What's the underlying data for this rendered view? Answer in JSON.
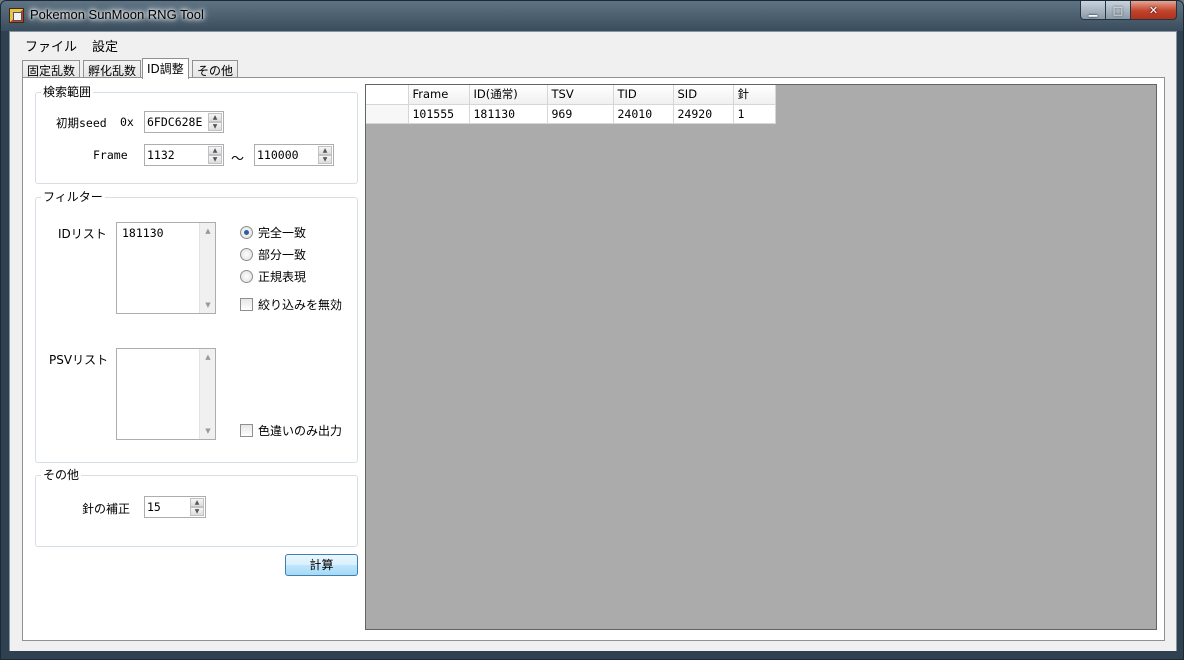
{
  "window": {
    "title": "Pokemon SunMoon RNG Tool",
    "buttons": {
      "minimize": "▁",
      "maximize": "□",
      "close": "✕"
    }
  },
  "menu": {
    "file": "ファイル",
    "settings": "設定"
  },
  "tabs": [
    "固定乱数",
    "孵化乱数",
    "ID調整",
    "その他"
  ],
  "active_tab": "ID調整",
  "search_range": {
    "title": "検索範囲",
    "seed_label": "初期seed",
    "hex_prefix": "0x",
    "seed_value": "6FDC628E",
    "frame_label": "Frame",
    "frame_start": "1132",
    "range_sep": "～",
    "frame_end": "110000"
  },
  "filter": {
    "title": "フィルター",
    "id_list_label": "IDリスト",
    "id_list_value": "181130",
    "match_options": [
      "完全一致",
      "部分一致",
      "正規表現"
    ],
    "selected_match": "完全一致",
    "disable_filter_label": "絞り込みを無効",
    "psv_list_label": "PSVリスト",
    "psv_list_value": "",
    "shiny_only_label": "色違いのみ出力"
  },
  "other": {
    "title": "その他",
    "needle_label": "針の補正",
    "needle_value": "15"
  },
  "calc_button": "計算",
  "results": {
    "columns": [
      "Frame",
      "ID(通常)",
      "TSV",
      "TID",
      "SID",
      "針"
    ],
    "rows": [
      [
        "101555",
        "181130",
        "969",
        "24010",
        "24920",
        "1"
      ]
    ]
  },
  "colors": {
    "grid_background": "#ababab",
    "button_border": "#3c7fb1",
    "radio_dot": "#2a5fa3"
  }
}
